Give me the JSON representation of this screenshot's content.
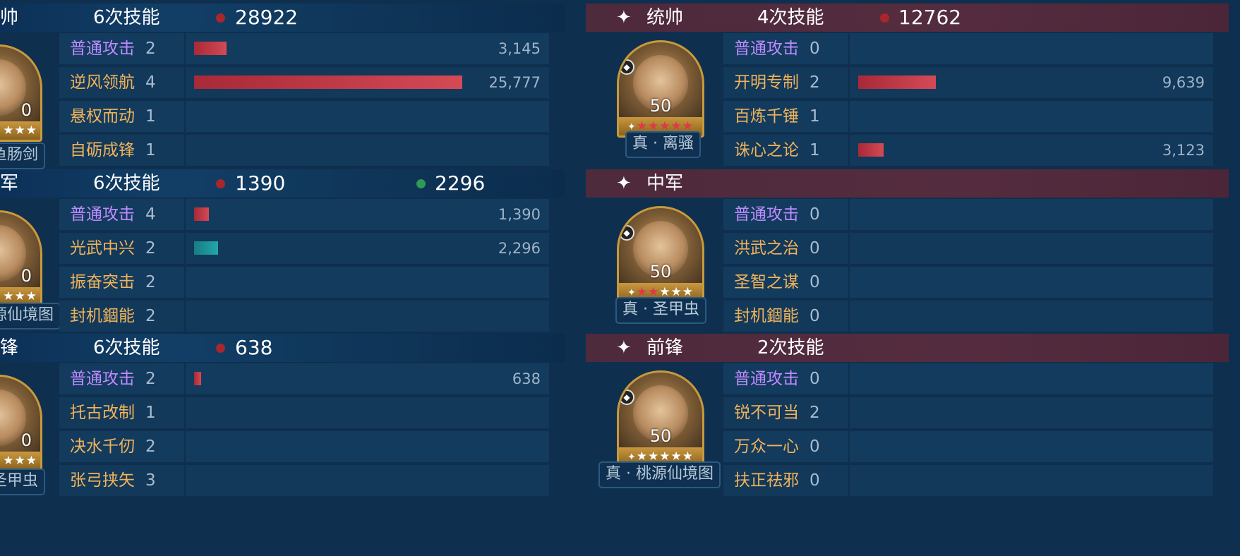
{
  "left": {
    "sections": [
      {
        "role": "帅",
        "skills": "6次技能",
        "damage_red": "28922",
        "damage_green": "",
        "hero": {
          "level": "0",
          "gear": "鱼肠剑",
          "stars": "★★★"
        },
        "rows": [
          {
            "name": "普通攻击",
            "type": "attack",
            "count": "2",
            "bar": "red",
            "fill": 0.12,
            "value": "3,145"
          },
          {
            "name": "逆风领航",
            "type": "tactic",
            "count": "4",
            "bar": "red",
            "fill": 1.0,
            "value": "25,777"
          },
          {
            "name": "悬权而动",
            "type": "tactic",
            "count": "1",
            "bar": "",
            "fill": 0,
            "value": ""
          },
          {
            "name": "自砺成锋",
            "type": "tactic",
            "count": "1",
            "bar": "",
            "fill": 0,
            "value": ""
          }
        ]
      },
      {
        "role": "军",
        "skills": "6次技能",
        "damage_red": "1390",
        "damage_green": "2296",
        "hero": {
          "level": "0",
          "gear": "源仙境图",
          "stars": "★★★"
        },
        "rows": [
          {
            "name": "普通攻击",
            "type": "attack",
            "count": "4",
            "bar": "red",
            "fill": 0.055,
            "value": "1,390"
          },
          {
            "name": "光武中兴",
            "type": "tactic",
            "count": "2",
            "bar": "teal",
            "fill": 0.09,
            "value": "2,296"
          },
          {
            "name": "振奋突击",
            "type": "tactic",
            "count": "2",
            "bar": "",
            "fill": 0,
            "value": ""
          },
          {
            "name": "封机錮能",
            "type": "tactic",
            "count": "2",
            "bar": "",
            "fill": 0,
            "value": ""
          }
        ]
      },
      {
        "role": "锋",
        "skills": "6次技能",
        "damage_red": "638",
        "damage_green": "",
        "hero": {
          "level": "0",
          "gear": "圣甲虫",
          "stars": "★★★"
        },
        "rows": [
          {
            "name": "普通攻击",
            "type": "attack",
            "count": "2",
            "bar": "red",
            "fill": 0.025,
            "value": "638"
          },
          {
            "name": "托古改制",
            "type": "tactic",
            "count": "1",
            "bar": "",
            "fill": 0,
            "value": ""
          },
          {
            "name": "决水千仞",
            "type": "tactic",
            "count": "2",
            "bar": "",
            "fill": 0,
            "value": ""
          },
          {
            "name": "张弓挟矢",
            "type": "tactic",
            "count": "3",
            "bar": "",
            "fill": 0,
            "value": ""
          }
        ]
      }
    ]
  },
  "right": {
    "sections": [
      {
        "role": "统帅",
        "skills": "4次技能",
        "damage_red": "12762",
        "hero": {
          "level": "50",
          "gear": "真 · 离骚",
          "stars_red": 5,
          "stars_white": 0
        },
        "rows": [
          {
            "name": "普通攻击",
            "type": "attack",
            "count": "0",
            "bar": "",
            "fill": 0,
            "value": ""
          },
          {
            "name": "开明专制",
            "type": "tactic",
            "count": "2",
            "bar": "red",
            "fill": 0.29,
            "value": "9,639"
          },
          {
            "name": "百炼千锤",
            "type": "tactic",
            "count": "1",
            "bar": "",
            "fill": 0,
            "value": ""
          },
          {
            "name": "诛心之论",
            "type": "tactic",
            "count": "1",
            "bar": "red",
            "fill": 0.095,
            "value": "3,123"
          }
        ]
      },
      {
        "role": "中军",
        "skills": "",
        "damage_red": "",
        "hero": {
          "level": "50",
          "gear": "真 · 圣甲虫",
          "stars_red": 2,
          "stars_white": 3
        },
        "rows": [
          {
            "name": "普通攻击",
            "type": "attack",
            "count": "0",
            "bar": "",
            "fill": 0,
            "value": ""
          },
          {
            "name": "洪武之治",
            "type": "tactic",
            "count": "0",
            "bar": "",
            "fill": 0,
            "value": ""
          },
          {
            "name": "圣智之谋",
            "type": "tactic",
            "count": "0",
            "bar": "",
            "fill": 0,
            "value": ""
          },
          {
            "name": "封机錮能",
            "type": "tactic",
            "count": "0",
            "bar": "",
            "fill": 0,
            "value": ""
          }
        ]
      },
      {
        "role": "前锋",
        "skills": "2次技能",
        "damage_red": "",
        "hero": {
          "level": "50",
          "gear": "真 · 桃源仙境图",
          "stars_red": 0,
          "stars_white": 5
        },
        "rows": [
          {
            "name": "普通攻击",
            "type": "attack",
            "count": "0",
            "bar": "",
            "fill": 0,
            "value": ""
          },
          {
            "name": "锐不可当",
            "type": "tactic",
            "count": "2",
            "bar": "",
            "fill": 0,
            "value": ""
          },
          {
            "name": "万众一心",
            "type": "tactic",
            "count": "0",
            "bar": "",
            "fill": 0,
            "value": ""
          },
          {
            "name": "扶正祛邪",
            "type": "tactic",
            "count": "0",
            "bar": "",
            "fill": 0,
            "value": ""
          }
        ]
      }
    ]
  },
  "colors": {
    "bar_red": "#c23a48",
    "bar_teal": "#1f9b9d",
    "attack_text": "#c08bff",
    "tactic_text": "#f0b35a"
  },
  "icons": {
    "header": "sparkle-icon",
    "damage_red": "red-dot-icon",
    "damage_green": "green-dot-icon"
  }
}
